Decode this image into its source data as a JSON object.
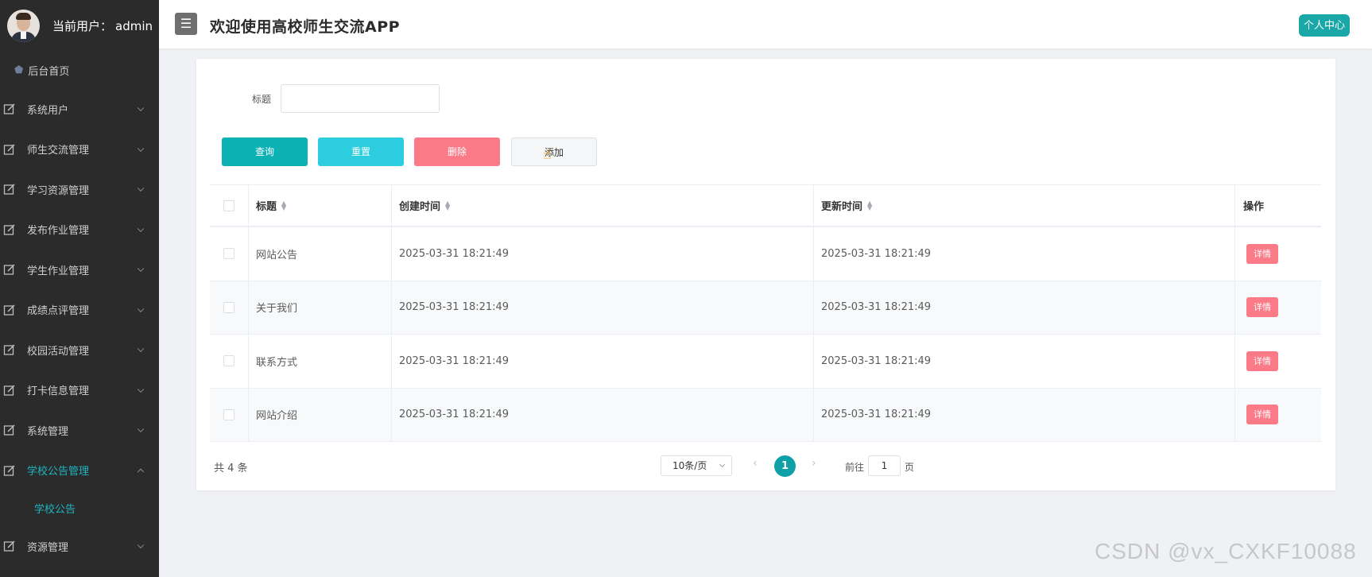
{
  "app": {
    "title": "欢迎使用高校师生交流APP",
    "current_user_label": "当前用户：",
    "username": "admin",
    "profile_button": "个人中心",
    "menu_button_glyph": "☰"
  },
  "sidebar": {
    "home": "后台首页",
    "items": [
      {
        "label": "系统用户"
      },
      {
        "label": "师生交流管理"
      },
      {
        "label": "学习资源管理"
      },
      {
        "label": "发布作业管理"
      },
      {
        "label": "学生作业管理"
      },
      {
        "label": "成绩点评管理"
      },
      {
        "label": "校园活动管理"
      },
      {
        "label": "打卡信息管理"
      },
      {
        "label": "系统管理"
      },
      {
        "label": "学校公告管理",
        "expanded": true,
        "children": [
          "学校公告"
        ]
      },
      {
        "label": "资源管理"
      }
    ]
  },
  "filter": {
    "title_label": "标题",
    "title_value": ""
  },
  "actions": {
    "query": "查询",
    "reset": "重置",
    "delete": "删除",
    "add": "添加"
  },
  "table": {
    "headers": {
      "title": "标题",
      "created": "创建时间",
      "updated": "更新时间",
      "op": "操作"
    },
    "detail_label": "详情",
    "rows": [
      {
        "title": "网站公告",
        "created": "2025-03-31 18:21:49",
        "updated": "2025-03-31 18:21:49"
      },
      {
        "title": "关于我们",
        "created": "2025-03-31 18:21:49",
        "updated": "2025-03-31 18:21:49"
      },
      {
        "title": "联系方式",
        "created": "2025-03-31 18:21:49",
        "updated": "2025-03-31 18:21:49"
      },
      {
        "title": "网站介绍",
        "created": "2025-03-31 18:21:49",
        "updated": "2025-03-31 18:21:49"
      }
    ]
  },
  "pagination": {
    "total": "共 4 条",
    "page_size": "10条/页",
    "current_page": "1",
    "goto_label": "前往",
    "goto_value": "1",
    "goto_suffix": "页"
  },
  "watermark": "CSDN @vx_CXKF10088",
  "colors": {
    "sidebar_bg": "#2b2b2b",
    "accent": "#1aa7a8",
    "query": "#0cb1b4",
    "reset": "#2dcde0",
    "delete": "#fb7a88"
  }
}
